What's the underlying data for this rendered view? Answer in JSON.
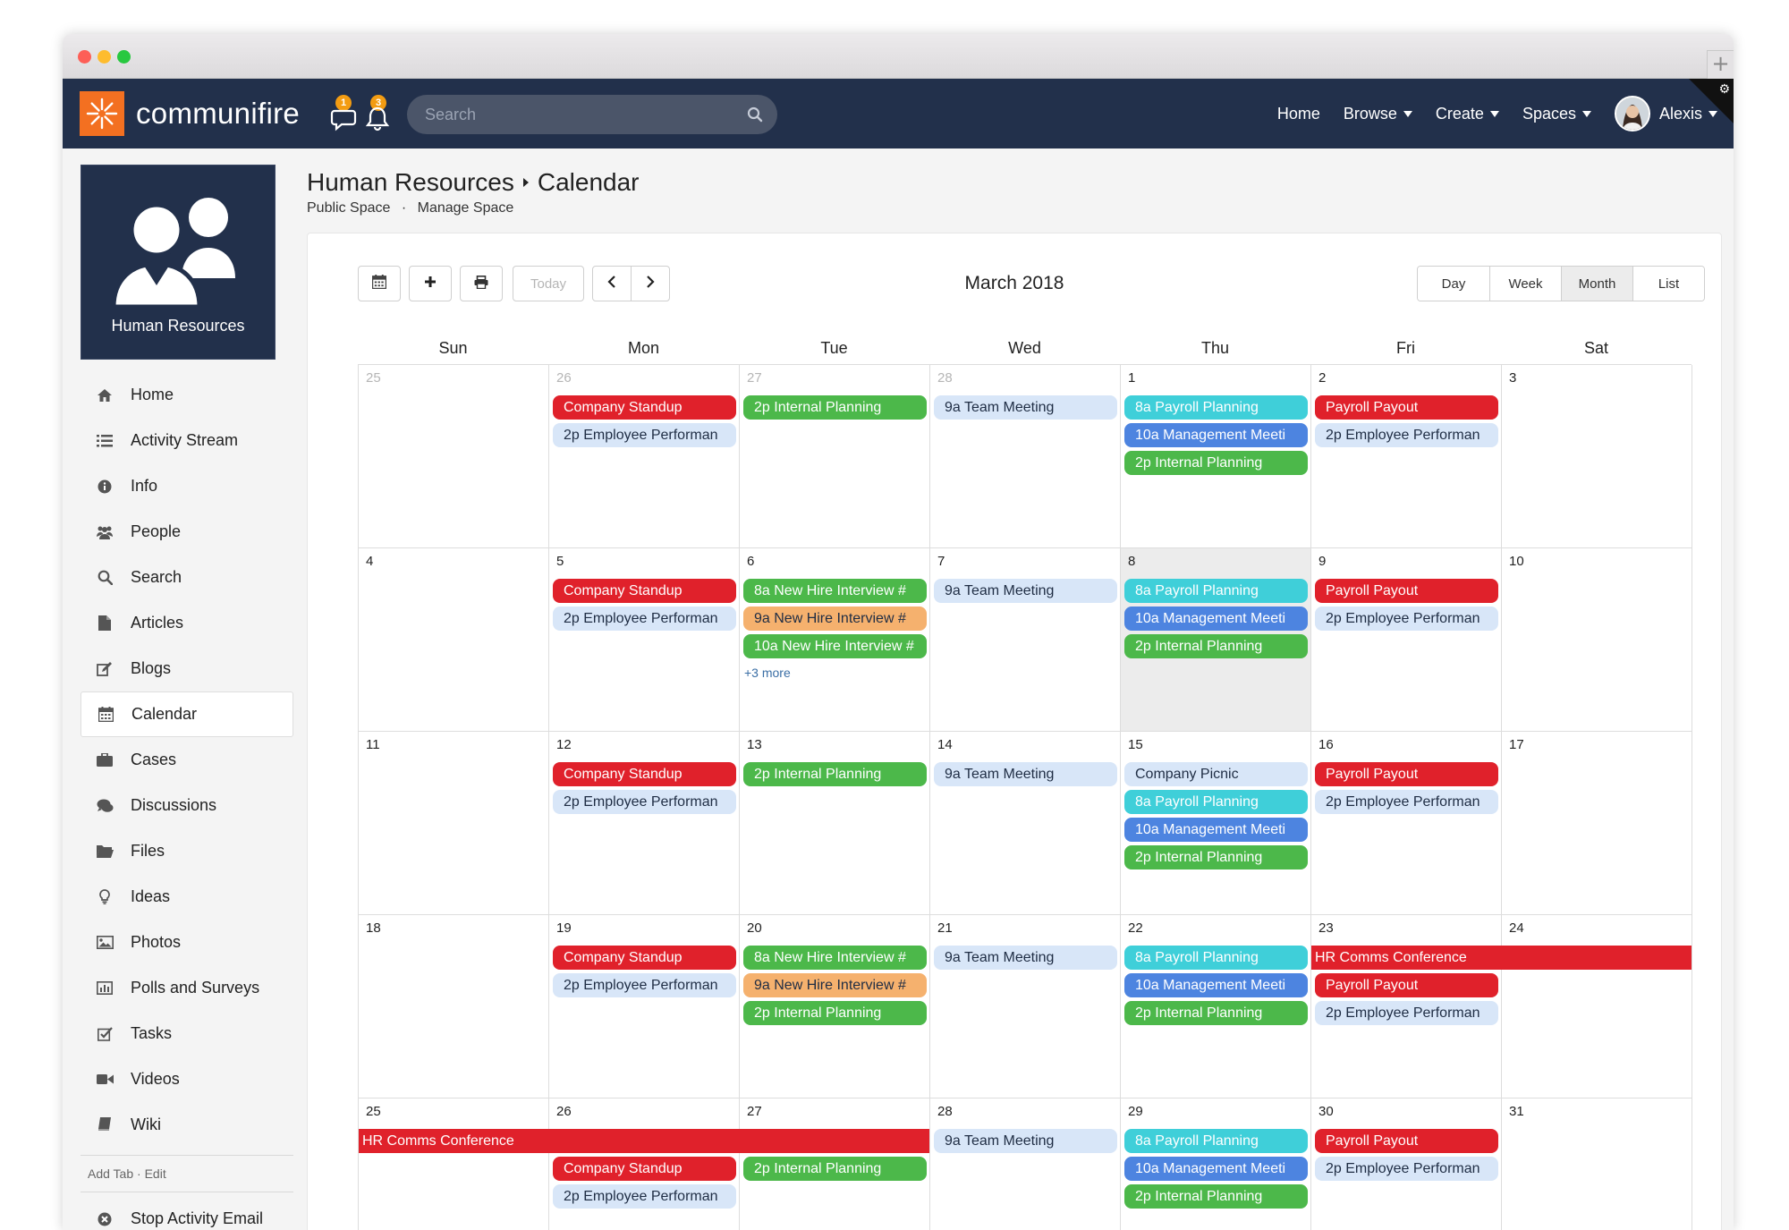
{
  "app": {
    "brand": "communifire",
    "notif_messages": "1",
    "notif_alerts": "3",
    "search_placeholder": "Search",
    "nav": [
      {
        "label": "Home",
        "dropdown": false
      },
      {
        "label": "Browse",
        "dropdown": true
      },
      {
        "label": "Create",
        "dropdown": true
      },
      {
        "label": "Spaces",
        "dropdown": true
      }
    ],
    "user": "Alexis"
  },
  "space": {
    "card_title": "Human Resources",
    "breadcrumb": [
      "Human Resources",
      "Calendar"
    ],
    "sub_links": [
      "Public Space",
      "Manage Space"
    ],
    "sub_separator": "·"
  },
  "sidebar": {
    "items": [
      {
        "label": "Home",
        "icon": "home-icon",
        "active": false
      },
      {
        "label": "Activity Stream",
        "icon": "list-icon",
        "active": false
      },
      {
        "label": "Info",
        "icon": "info-icon",
        "active": false
      },
      {
        "label": "People",
        "icon": "people-icon",
        "active": false
      },
      {
        "label": "Search",
        "icon": "search-icon",
        "active": false
      },
      {
        "label": "Articles",
        "icon": "file-icon",
        "active": false
      },
      {
        "label": "Blogs",
        "icon": "blog-icon",
        "active": false
      },
      {
        "label": "Calendar",
        "icon": "calendar-icon",
        "active": true
      },
      {
        "label": "Cases",
        "icon": "briefcase-icon",
        "active": false
      },
      {
        "label": "Discussions",
        "icon": "chat-icon",
        "active": false
      },
      {
        "label": "Files",
        "icon": "folder-icon",
        "active": false
      },
      {
        "label": "Ideas",
        "icon": "lightbulb-icon",
        "active": false
      },
      {
        "label": "Photos",
        "icon": "image-icon",
        "active": false
      },
      {
        "label": "Polls and Surveys",
        "icon": "bar-chart-icon",
        "active": false
      },
      {
        "label": "Tasks",
        "icon": "checkbox-icon",
        "active": false
      },
      {
        "label": "Videos",
        "icon": "video-icon",
        "active": false
      },
      {
        "label": "Wiki",
        "icon": "book-icon",
        "active": false
      }
    ],
    "add_tab": "Add Tab",
    "edit": "Edit",
    "footer_item": "Stop Activity Email"
  },
  "calendar": {
    "title": "March 2018",
    "today_label": "Today",
    "views": [
      "Day",
      "Week",
      "Month",
      "List"
    ],
    "active_view": "Month",
    "weekdays": [
      "Sun",
      "Mon",
      "Tue",
      "Wed",
      "Thu",
      "Fri",
      "Sat"
    ],
    "more_label": "+3 more",
    "colors": {
      "red": "#e0212b",
      "light": "#d8e6f8",
      "green": "#4cb84a",
      "cyan": "#3fcfd9",
      "blue": "#4d84e0",
      "orange": "#f5b16e"
    },
    "weeks": [
      {
        "days": [
          {
            "num": "25",
            "other": true
          },
          {
            "num": "26",
            "other": true
          },
          {
            "num": "27",
            "other": true
          },
          {
            "num": "28",
            "other": true
          },
          {
            "num": "1"
          },
          {
            "num": "2"
          },
          {
            "num": "3"
          }
        ]
      },
      {
        "days": [
          {
            "num": "4"
          },
          {
            "num": "5"
          },
          {
            "num": "6"
          },
          {
            "num": "7"
          },
          {
            "num": "8",
            "today": true
          },
          {
            "num": "9"
          },
          {
            "num": "10"
          }
        ]
      },
      {
        "days": [
          {
            "num": "11"
          },
          {
            "num": "12"
          },
          {
            "num": "13"
          },
          {
            "num": "14"
          },
          {
            "num": "15"
          },
          {
            "num": "16"
          },
          {
            "num": "17"
          }
        ]
      },
      {
        "days": [
          {
            "num": "18"
          },
          {
            "num": "19"
          },
          {
            "num": "20"
          },
          {
            "num": "21"
          },
          {
            "num": "22"
          },
          {
            "num": "23"
          },
          {
            "num": "24"
          }
        ]
      },
      {
        "days": [
          {
            "num": "25"
          },
          {
            "num": "26"
          },
          {
            "num": "27"
          },
          {
            "num": "28"
          },
          {
            "num": "29"
          },
          {
            "num": "30"
          },
          {
            "num": "31"
          }
        ]
      }
    ],
    "events": [
      {
        "week": 0,
        "day": 1,
        "slot": 0,
        "span": 1,
        "label": "Company Standup",
        "color": "red"
      },
      {
        "week": 0,
        "day": 1,
        "slot": 1,
        "span": 1,
        "label": "2p Employee Performan",
        "color": "light"
      },
      {
        "week": 0,
        "day": 2,
        "slot": 0,
        "span": 1,
        "label": "2p Internal Planning",
        "color": "green"
      },
      {
        "week": 0,
        "day": 3,
        "slot": 0,
        "span": 1,
        "label": "9a Team Meeting",
        "color": "light"
      },
      {
        "week": 0,
        "day": 4,
        "slot": 0,
        "span": 1,
        "label": "8a Payroll Planning",
        "color": "cyan"
      },
      {
        "week": 0,
        "day": 4,
        "slot": 1,
        "span": 1,
        "label": "10a Management Meeti",
        "color": "blue"
      },
      {
        "week": 0,
        "day": 4,
        "slot": 2,
        "span": 1,
        "label": "2p Internal Planning",
        "color": "green"
      },
      {
        "week": 0,
        "day": 5,
        "slot": 0,
        "span": 1,
        "label": "Payroll Payout",
        "color": "red"
      },
      {
        "week": 0,
        "day": 5,
        "slot": 1,
        "span": 1,
        "label": "2p Employee Performan",
        "color": "light"
      },
      {
        "week": 1,
        "day": 1,
        "slot": 0,
        "span": 1,
        "label": "Company Standup",
        "color": "red"
      },
      {
        "week": 1,
        "day": 1,
        "slot": 1,
        "span": 1,
        "label": "2p Employee Performan",
        "color": "light"
      },
      {
        "week": 1,
        "day": 2,
        "slot": 0,
        "span": 1,
        "label": "8a New Hire Interview #",
        "color": "green"
      },
      {
        "week": 1,
        "day": 2,
        "slot": 1,
        "span": 1,
        "label": "9a New Hire Interview #",
        "color": "orange"
      },
      {
        "week": 1,
        "day": 2,
        "slot": 2,
        "span": 1,
        "label": "10a New Hire Interview #",
        "color": "green"
      },
      {
        "week": 1,
        "day": 3,
        "slot": 0,
        "span": 1,
        "label": "9a Team Meeting",
        "color": "light"
      },
      {
        "week": 1,
        "day": 4,
        "slot": 0,
        "span": 1,
        "label": "8a Payroll Planning",
        "color": "cyan"
      },
      {
        "week": 1,
        "day": 4,
        "slot": 1,
        "span": 1,
        "label": "10a Management Meeti",
        "color": "blue"
      },
      {
        "week": 1,
        "day": 4,
        "slot": 2,
        "span": 1,
        "label": "2p Internal Planning",
        "color": "green"
      },
      {
        "week": 1,
        "day": 5,
        "slot": 0,
        "span": 1,
        "label": "Payroll Payout",
        "color": "red"
      },
      {
        "week": 1,
        "day": 5,
        "slot": 1,
        "span": 1,
        "label": "2p Employee Performan",
        "color": "light"
      },
      {
        "week": 2,
        "day": 1,
        "slot": 0,
        "span": 1,
        "label": "Company Standup",
        "color": "red"
      },
      {
        "week": 2,
        "day": 1,
        "slot": 1,
        "span": 1,
        "label": "2p Employee Performan",
        "color": "light"
      },
      {
        "week": 2,
        "day": 2,
        "slot": 0,
        "span": 1,
        "label": "2p Internal Planning",
        "color": "green"
      },
      {
        "week": 2,
        "day": 3,
        "slot": 0,
        "span": 1,
        "label": "9a Team Meeting",
        "color": "light"
      },
      {
        "week": 2,
        "day": 4,
        "slot": 0,
        "span": 1,
        "label": "Company Picnic",
        "color": "light"
      },
      {
        "week": 2,
        "day": 4,
        "slot": 1,
        "span": 1,
        "label": "8a Payroll Planning",
        "color": "cyan"
      },
      {
        "week": 2,
        "day": 4,
        "slot": 2,
        "span": 1,
        "label": "10a Management Meeti",
        "color": "blue"
      },
      {
        "week": 2,
        "day": 4,
        "slot": 3,
        "span": 1,
        "label": "2p Internal Planning",
        "color": "green"
      },
      {
        "week": 2,
        "day": 5,
        "slot": 0,
        "span": 1,
        "label": "Payroll Payout",
        "color": "red"
      },
      {
        "week": 2,
        "day": 5,
        "slot": 1,
        "span": 1,
        "label": "2p Employee Performan",
        "color": "light"
      },
      {
        "week": 3,
        "day": 1,
        "slot": 0,
        "span": 1,
        "label": "Company Standup",
        "color": "red"
      },
      {
        "week": 3,
        "day": 1,
        "slot": 1,
        "span": 1,
        "label": "2p Employee Performan",
        "color": "light"
      },
      {
        "week": 3,
        "day": 2,
        "slot": 0,
        "span": 1,
        "label": "8a New Hire Interview #",
        "color": "green"
      },
      {
        "week": 3,
        "day": 2,
        "slot": 1,
        "span": 1,
        "label": "9a New Hire Interview #",
        "color": "orange"
      },
      {
        "week": 3,
        "day": 2,
        "slot": 2,
        "span": 1,
        "label": "2p Internal Planning",
        "color": "green"
      },
      {
        "week": 3,
        "day": 3,
        "slot": 0,
        "span": 1,
        "label": "9a Team Meeting",
        "color": "light"
      },
      {
        "week": 3,
        "day": 4,
        "slot": 0,
        "span": 1,
        "label": "8a Payroll Planning",
        "color": "cyan"
      },
      {
        "week": 3,
        "day": 4,
        "slot": 1,
        "span": 1,
        "label": "10a Management Meeti",
        "color": "blue"
      },
      {
        "week": 3,
        "day": 4,
        "slot": 2,
        "span": 1,
        "label": "2p Internal Planning",
        "color": "green"
      },
      {
        "week": 3,
        "day": 5,
        "slot": 0,
        "span": 2,
        "label": "HR Comms Conference",
        "color": "red",
        "flat": true
      },
      {
        "week": 3,
        "day": 5,
        "slot": 1,
        "span": 1,
        "label": "Payroll Payout",
        "color": "red"
      },
      {
        "week": 3,
        "day": 5,
        "slot": 2,
        "span": 1,
        "label": "2p Employee Performan",
        "color": "light"
      },
      {
        "week": 4,
        "day": 0,
        "slot": 0,
        "span": 3,
        "label": "HR Comms Conference",
        "color": "red",
        "flat": true
      },
      {
        "week": 4,
        "day": 1,
        "slot": 1,
        "span": 1,
        "label": "Company Standup",
        "color": "red"
      },
      {
        "week": 4,
        "day": 1,
        "slot": 2,
        "span": 1,
        "label": "2p Employee Performan",
        "color": "light"
      },
      {
        "week": 4,
        "day": 2,
        "slot": 1,
        "span": 1,
        "label": "2p Internal Planning",
        "color": "green"
      },
      {
        "week": 4,
        "day": 3,
        "slot": 0,
        "span": 1,
        "label": "9a Team Meeting",
        "color": "light"
      },
      {
        "week": 4,
        "day": 4,
        "slot": 0,
        "span": 1,
        "label": "8a Payroll Planning",
        "color": "cyan"
      },
      {
        "week": 4,
        "day": 4,
        "slot": 1,
        "span": 1,
        "label": "10a Management Meeti",
        "color": "blue"
      },
      {
        "week": 4,
        "day": 4,
        "slot": 2,
        "span": 1,
        "label": "2p Internal Planning",
        "color": "green"
      },
      {
        "week": 4,
        "day": 5,
        "slot": 0,
        "span": 1,
        "label": "Payroll Payout",
        "color": "red"
      },
      {
        "week": 4,
        "day": 5,
        "slot": 1,
        "span": 1,
        "label": "2p Employee Performan",
        "color": "light"
      }
    ],
    "more": [
      {
        "week": 1,
        "day": 2,
        "slot": 3
      }
    ]
  }
}
